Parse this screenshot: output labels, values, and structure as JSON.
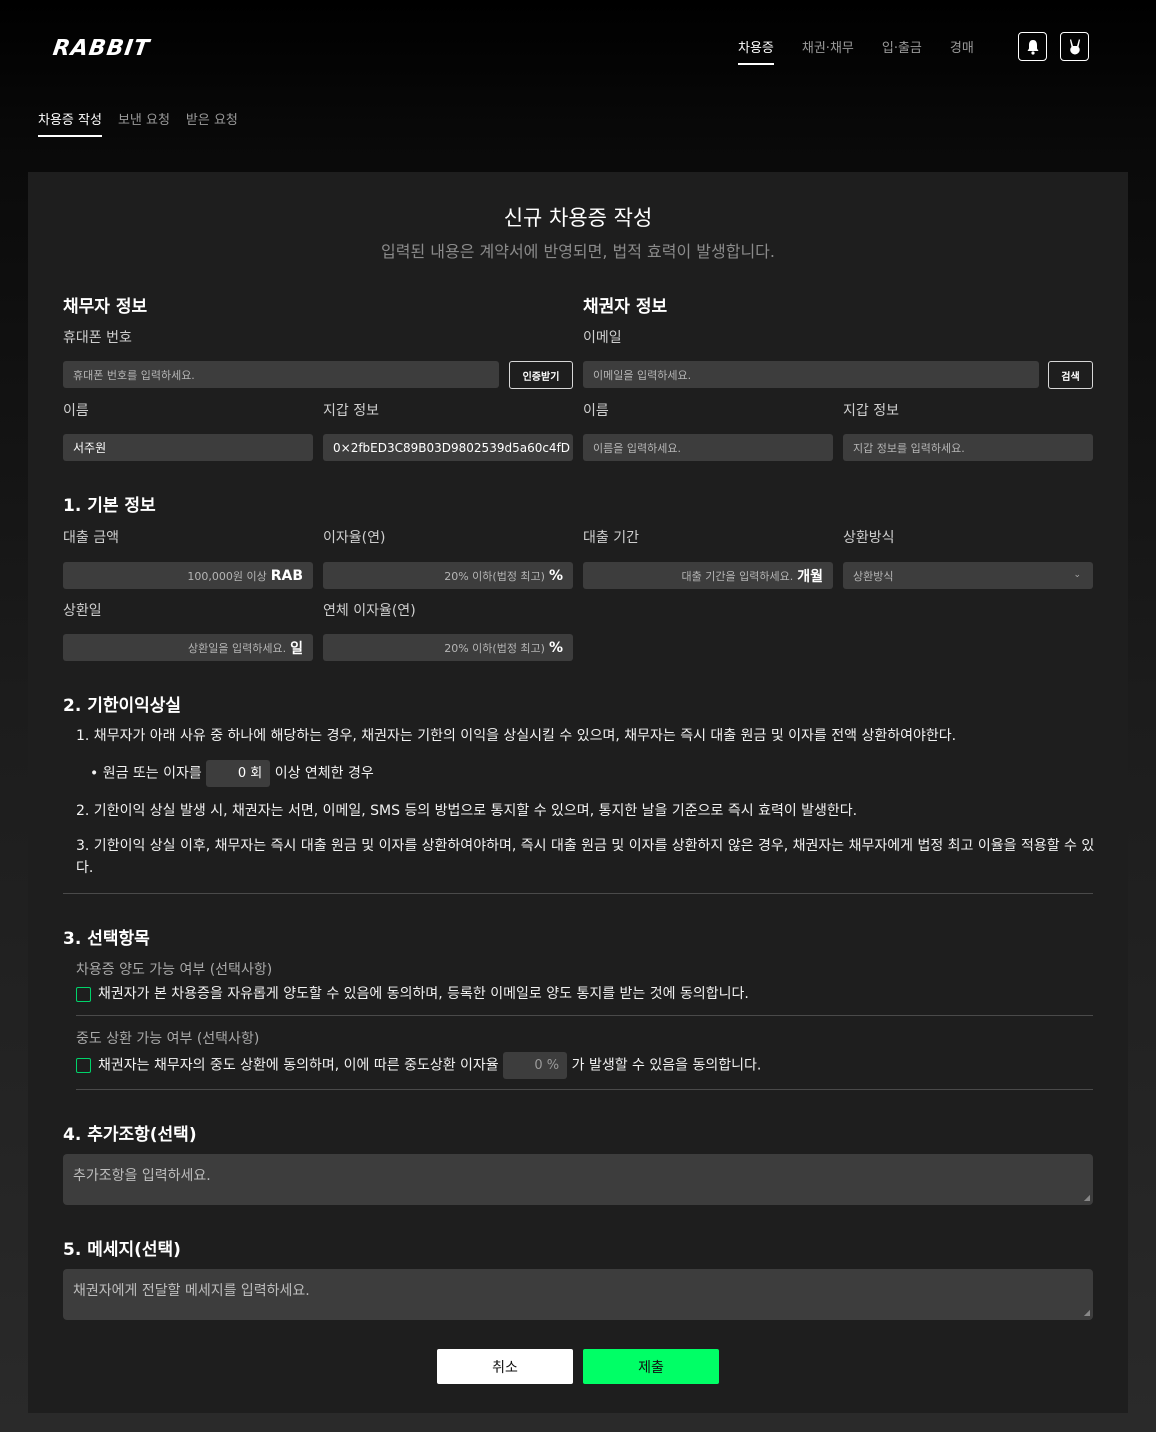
{
  "header": {
    "logo": "RABBIT",
    "nav": [
      "차용증",
      "채권·채무",
      "입·출금",
      "경매"
    ],
    "active_nav": "차용증"
  },
  "subtabs": [
    "차용증 작성",
    "보낸 요청",
    "받은 요청"
  ],
  "form": {
    "title": "신규 차용증 작성",
    "subtitle": "입력된 내용은 계약서에 반영되면, 법적 효력이 발생합니다.",
    "debtor": {
      "title": "채무자 정보",
      "phone_label": "휴대폰 번호",
      "phone_placeholder": "휴대폰 번호를 입력하세요.",
      "verify_button": "인증받기",
      "name_label": "이름",
      "name_value": "서주원",
      "wallet_label": "지갑 정보",
      "wallet_value": "0×2fbED3C89B03D9802539d5a60c4fD"
    },
    "creditor": {
      "title": "채권자 정보",
      "email_label": "이메일",
      "email_placeholder": "이메일을 입력하세요.",
      "search_button": "검색",
      "name_label": "이름",
      "name_placeholder": "이름을 입력하세요.",
      "wallet_label": "지갑 정보",
      "wallet_placeholder": "지갑 정보를 입력하세요."
    },
    "basic": {
      "title": "1. 기본 정보",
      "amount_label": "대출 금액",
      "amount_placeholder": "100,000원 이상",
      "amount_unit": "RAB",
      "rate_label": "이자율(연)",
      "rate_placeholder": "20% 이하(법정 최고)",
      "rate_unit": "%",
      "period_label": "대출 기간",
      "period_placeholder": "대출 기간을 입력하세요.",
      "period_unit": "개월",
      "method_label": "상환방식",
      "method_value": "상환방식",
      "repay_day_label": "상환일",
      "repay_day_placeholder": "상환일을 입력하세요.",
      "repay_day_unit": "일",
      "overdue_label": "연체 이자율(연)",
      "overdue_placeholder": "20% 이하(법정 최고)",
      "overdue_unit": "%"
    },
    "acceleration": {
      "title": "2. 기한이익상실",
      "item1": "1. 채무자가 아래 사유 중 하나에 해당하는 경우, 채권자는 기한의 이익을 상실시킬 수 있으며, 채무자는 즉시 대출 원금 및 이자를 전액 상환하여야한다.",
      "bullet_prefix": "• 원금 또는 이자를",
      "bullet_value": "0",
      "bullet_unit": "회",
      "bullet_suffix": "이상 연체한 경우",
      "item2": "2. 기한이익 상실 발생 시, 채권자는 서면, 이메일, SMS 등의 방법으로 통지할 수 있으며, 통지한 날을 기준으로 즉시 효력이 발생한다.",
      "item3": "3. 기한이익 상실 이후, 채무자는 즉시 대출 원금 및 이자를 상환하여야하며, 즉시 대출 원금 및 이자를 상환하지 않은 경우, 채권자는 채무자에게 법정 최고 이율을 적용할 수 있다."
    },
    "options": {
      "title": "3. 선택항목",
      "transfer_label": "차용증 양도 가능 여부 (선택사항)",
      "transfer_text": "채권자가 본 차용증을 자유롭게 양도할 수 있음에 동의하며, 등록한 이메일로 양도 통지를 받는 것에 동의합니다.",
      "early_label": "중도 상환 가능 여부 (선택사항)",
      "early_prefix": "채권자는 채무자의 중도 상환에 동의하며, 이에 따른 중도상환 이자율",
      "early_value": "0",
      "early_unit": "%",
      "early_suffix": "가 발생할 수 있음을 동의합니다."
    },
    "extra": {
      "title": "4. 추가조항(선택)",
      "placeholder": "추가조항을 입력하세요."
    },
    "message": {
      "title": "5. 메세지(선택)",
      "placeholder": "채권자에게 전달할 메세지를 입력하세요."
    },
    "cancel_button": "취소",
    "submit_button": "제출"
  },
  "colors": {
    "accent": "#00ff66",
    "checkbox": "#00d36a",
    "input_bg": "#3d3d3d",
    "card_bg": "#1e1e1e"
  }
}
